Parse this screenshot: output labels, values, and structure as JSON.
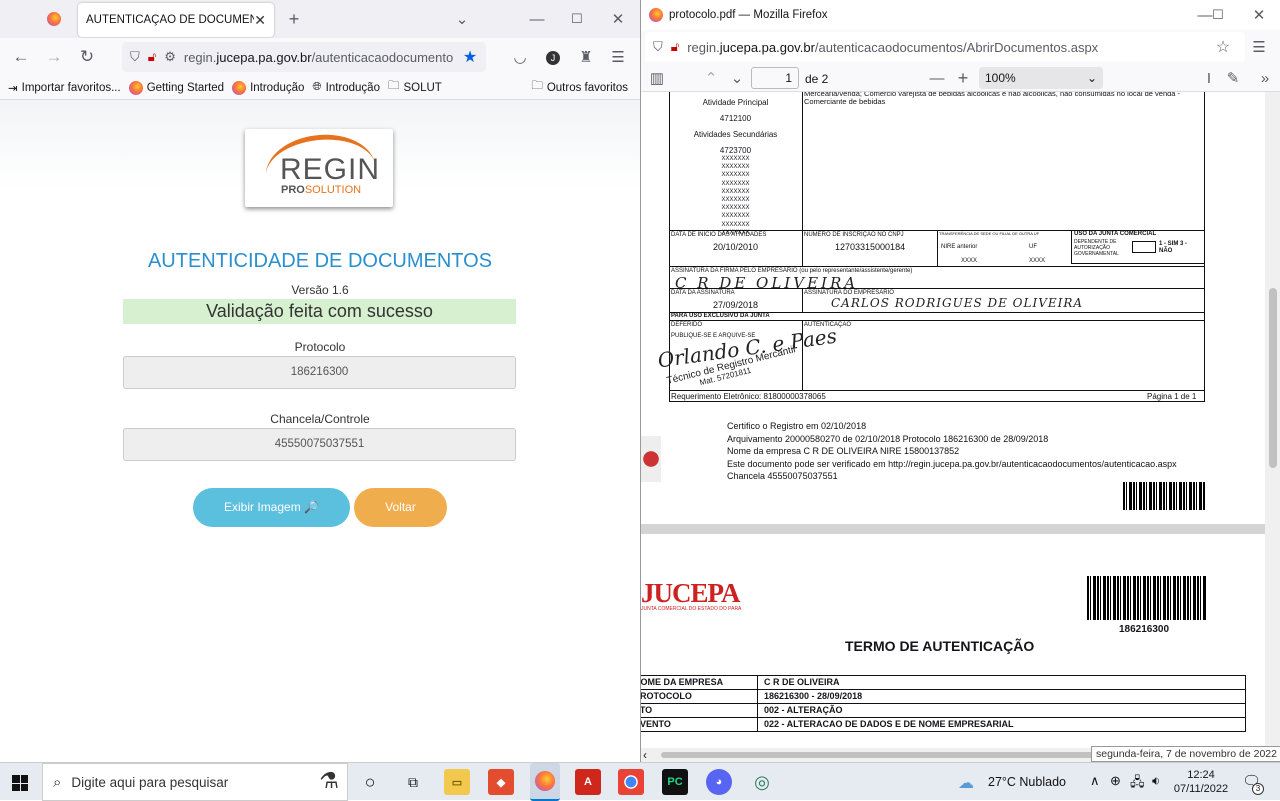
{
  "left": {
    "tab_title": "AUTENTICAÇÃO DE DOCUMENTOS",
    "url_domain": "regin.",
    "url_host": "jucepa.pa.gov.br",
    "url_path": "/autenticacaodocumento",
    "bookmarks": [
      "Importar favoritos...",
      "Getting Started",
      "Introdução",
      "Introdução",
      "SOLUT"
    ],
    "other_bookmarks": "Outros favoritos",
    "avatar_letter": "J",
    "logo_main": "REGIN",
    "logo_sub_a": "PRO",
    "logo_sub_b": "SOLUTION",
    "title": "AUTENTICIDADE DE DOCUMENTOS",
    "version": "Versão 1.6",
    "success": "Validação feita com sucesso",
    "protocolo_label": "Protocolo",
    "protocolo_value": "186216300",
    "chancela_label": "Chancela/Controle",
    "chancela_value": "45550075037551",
    "btn_image": "Exibir Imagem 🔎",
    "btn_back": "Voltar"
  },
  "right": {
    "window_title": "protocolo.pdf — Mozilla Firefox",
    "url_domain": "regin.",
    "url_host": "jucepa.pa.gov.br",
    "url_path": "/autenticacaodocumentos/AbrirDocumentos.aspx",
    "page_current": "1",
    "page_total": "de 2",
    "zoom": "100%",
    "doc1": {
      "line0": "Mercearia/venda; Comércio varejista de bebidas alcoólicas e não alcoólicas, não consumidas no local de venda - Comerciante de bebidas",
      "ativ_principal_label": "Atividade Principal",
      "ativ_principal": "4712100",
      "ativ_sec_label": "Atividades Secundárias",
      "ativ_sec_code": "4723700",
      "xs": [
        "XXXXXXX",
        "XXXXXXX",
        "XXXXXXX",
        "XXXXXXX",
        "XXXXXXX",
        "XXXXXXX",
        "XXXXXXX",
        "XXXXXXX",
        "XXXXXXX",
        "XXXXXXX"
      ],
      "data_inicio_label": "DATA DE INÍCIO DAS ATIVIDADES",
      "data_inicio": "20/10/2010",
      "cnpj_label": "NÚMERO DE INSCRIÇÃO NO CNPJ",
      "cnpj": "12703315000184",
      "transf_label": "TRANSFERÊNCIA DE SEDE OU FILIAL DE OUTRA UF",
      "nire_ant_label": "NIRE anterior",
      "uf_label": "UF",
      "nire_ant": "XXXX",
      "uf": "XXXX",
      "uso_junta_label": "USO DA JUNTA COMERCIAL",
      "dependente_label": "DEPENDENTE DE AUTORIZAÇÃO GOVERNAMENTAL",
      "sim_nao": "1 - SIM  3 - NÃO",
      "assinatura_firma_label": "ASSINATURA DA FIRMA PELO EMPRESÁRIO (ou pelo representante/assistente/gerente)",
      "firma_sig": "C R DE OLIVEIRA",
      "data_assinatura_label": "DATA DA ASSINATURA",
      "data_assinatura": "27/09/2018",
      "assin_empresario_label": "ASSINATURA DO EMPRESÁRIO",
      "empresario_sig": "CARLOS RODRIGUES DE OLIVEIRA",
      "uso_exclusivo_label": "PARA USO EXCLUSIVO DA JUNTA",
      "deferido_label": "DEFERIDO",
      "publique_label": "PUBLIQUE-SE E ARQUIVE-SE",
      "autenticacao_label": "AUTENTICAÇÃO",
      "stamp_sig": "Orlando C. e Paes",
      "stamp_text": "Técnico de Registro Mercantil",
      "stamp_mat": "Mat. 57201811",
      "req_eletronico": "Requerimento Eletrônico: 81800000378065",
      "pagina": "Página 1 de 1",
      "cert_lines": [
        "Certifico o Registro em 02/10/2018",
        "Arquivamento 20000580270 de 02/10/2018 Protocolo 186216300 de 28/09/2018",
        "Nome da empresa C R DE OLIVEIRA NIRE 15800137852",
        "Este documento pode ser verificado em http://regin.jucepa.pa.gov.br/autenticacaodocumentos/autenticacao.aspx",
        "Chancela 45550075037551"
      ]
    },
    "doc2": {
      "logo": "JUCEPA",
      "logo_sub": "JUNTA COMERCIAL DO ESTADO DO PARÁ",
      "barcode_number": "186216300",
      "title": "TERMO DE AUTENTICAÇÃO",
      "rows": [
        {
          "k": "NOME DA EMPRESA",
          "v": "C R DE OLIVEIRA"
        },
        {
          "k": "PROTOCOLO",
          "v": "186216300 - 28/09/2018"
        },
        {
          "k": "ATO",
          "v": "002 - ALTERAÇÃO"
        },
        {
          "k": "EVENTO",
          "v": "022 - ALTERACAO DE DADOS E DE NOME EMPRESARIAL"
        }
      ]
    },
    "tooltip": "segunda-feira, 7 de novembro de 2022"
  },
  "taskbar": {
    "search_placeholder": "Digite aqui para pesquisar",
    "weather": "27°C  Nublado",
    "time": "12:24",
    "date": "07/11/2022",
    "notif_count": "3"
  }
}
